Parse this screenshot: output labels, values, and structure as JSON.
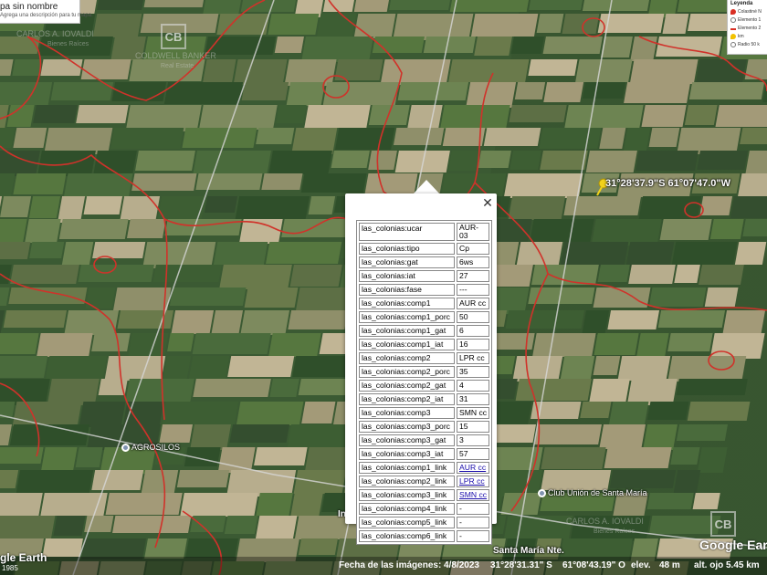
{
  "project": {
    "title": "pa sin nombre",
    "subtitle": "Agrega una descripción para tu mapa."
  },
  "legend": {
    "title": "Leyenda",
    "items": [
      {
        "label": "Colastiné N",
        "icon": "pin-icon",
        "color": "#d93025"
      },
      {
        "label": "Elemento 1",
        "icon": "circle-icon",
        "color": "#777777"
      },
      {
        "label": "Elemento 2",
        "icon": "line-icon",
        "color": "#d93025"
      },
      {
        "label": "km",
        "icon": "pin-icon",
        "color": "#f2c200"
      },
      {
        "label": "Radio 50 k",
        "icon": "circle-icon",
        "color": "#777777"
      }
    ]
  },
  "watermarks": {
    "agent_name": "CARLOS A. IOVALDI",
    "agent_sub": "Bienes Raíces",
    "brand": "COLDWELL BANKER",
    "brand_sub": "Real Estate",
    "logo": "CB",
    "agent_name_2": "CARLOS A. IOVALDI",
    "agent_sub_2": "Bienes Raíces"
  },
  "marker": {
    "coords": "31°28'37.9\"S 61°07'47.0\"W",
    "color": "#f2d21b"
  },
  "places": {
    "agrosilos": "AGROSILOS",
    "club": "Club Unión de Santa María",
    "street_fragment": "In",
    "town": "Santa María Nte."
  },
  "popup": {
    "close": "✕",
    "rows": [
      {
        "key": "las_colonias:ucar",
        "value": "AUR-03"
      },
      {
        "key": "las_colonias:tipo",
        "value": "Cp"
      },
      {
        "key": "las_colonias:gat",
        "value": "6ws"
      },
      {
        "key": "las_colonias:iat",
        "value": "27"
      },
      {
        "key": "las_colonias:fase",
        "value": "---"
      },
      {
        "key": "las_colonias:comp1",
        "value": "AUR cc"
      },
      {
        "key": "las_colonias:comp1_porc",
        "value": "50"
      },
      {
        "key": "las_colonias:comp1_gat",
        "value": "6"
      },
      {
        "key": "las_colonias:comp1_iat",
        "value": "16"
      },
      {
        "key": "las_colonias:comp2",
        "value": "LPR cc"
      },
      {
        "key": "las_colonias:comp2_porc",
        "value": "35"
      },
      {
        "key": "las_colonias:comp2_gat",
        "value": "4"
      },
      {
        "key": "las_colonias:comp2_iat",
        "value": "31"
      },
      {
        "key": "las_colonias:comp3",
        "value": "SMN cc"
      },
      {
        "key": "las_colonias:comp3_porc",
        "value": "15"
      },
      {
        "key": "las_colonias:comp3_gat",
        "value": "3"
      },
      {
        "key": "las_colonias:comp3_iat",
        "value": "57"
      },
      {
        "key": "las_colonias:comp1_link",
        "value": "AUR cc"
      },
      {
        "key": "las_colonias:comp2_link",
        "value": "LPR cc"
      },
      {
        "key": "las_colonias:comp3_link",
        "value": "SMN cc"
      },
      {
        "key": "las_colonias:comp4_link",
        "value": "-"
      },
      {
        "key": "las_colonias:comp5_link",
        "value": "-"
      },
      {
        "key": "las_colonias:comp6_link",
        "value": "-"
      }
    ]
  },
  "status": {
    "date": "Fecha de las imágenes: 4/8/2023",
    "lat": "31°28'31.31\" S",
    "lon": "61°08'43.19\" O",
    "elev_label": "elev.",
    "elev": "48 m",
    "alt": "alt. ojo 5.45 km",
    "year_left": "1985",
    "google_earth_left": "gle Earth",
    "google_earth_right": "Google Earth"
  },
  "colors": {
    "soil_line": "#d0322a",
    "road": "#d8d8d8"
  }
}
